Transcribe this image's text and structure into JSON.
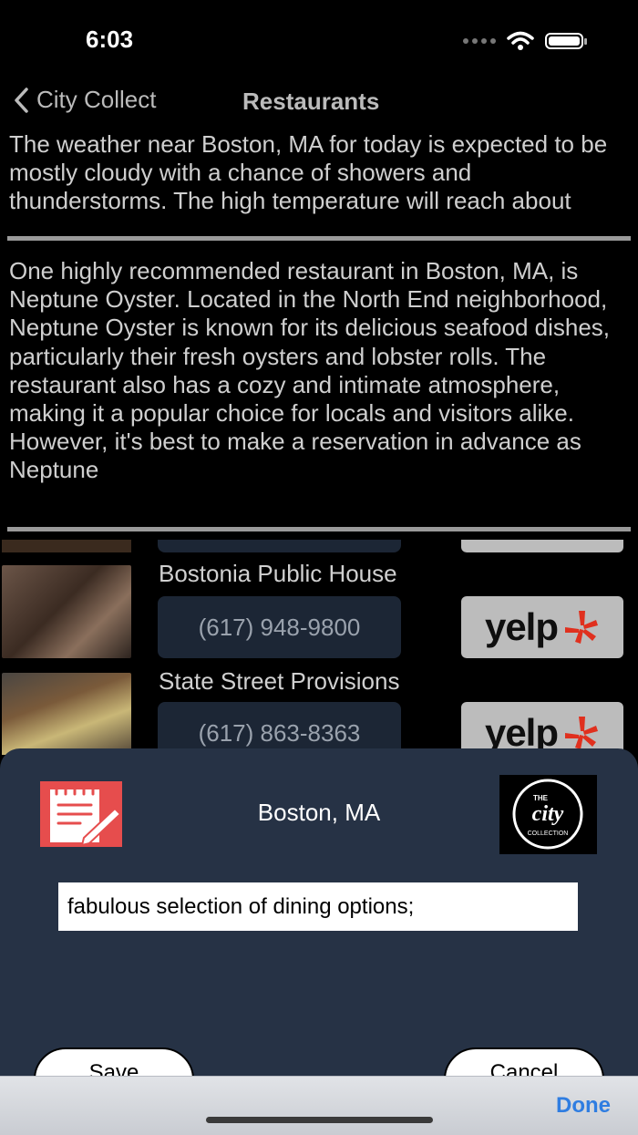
{
  "status": {
    "time": "6:03"
  },
  "nav": {
    "back_label": "City Collect",
    "title": "Restaurants"
  },
  "weather_text": "The weather near Boston, MA for today is expected to be mostly cloudy with a chance of showers and thunderstorms. The high temperature will reach about seventy-four degrees.",
  "recommendation_text": "One highly recommended restaurant in Boston, MA, is Neptune Oyster. Located in the North End neighborhood, Neptune Oyster is known for its delicious seafood dishes, particularly their fresh oysters and lobster rolls. The restaurant also has a cozy and intimate atmosphere, making it a popular choice for locals and visitors alike. However, it's best to make a reservation in advance as Neptune",
  "restaurants": [
    {
      "name": "Bostonia Public House",
      "phone": "(617) 948-9800",
      "yelp_label": "yelp"
    },
    {
      "name": "State Street Provisions",
      "phone": "(617) 863-8363",
      "yelp_label": "yelp"
    }
  ],
  "sheet": {
    "location": "Boston, MA",
    "note_value": "fabulous selection of dining options;",
    "save_label": "Save",
    "cancel_label": "Cancel",
    "logo_text_top": "THE",
    "logo_text_main": "city",
    "logo_text_bottom": "COLLECTION"
  },
  "keyboard": {
    "done_label": "Done"
  },
  "colors": {
    "sheet_bg": "#263245",
    "accent": "#2f7de1",
    "yelp_burst": "#e0301e",
    "notes_icon": "#e64d4d"
  }
}
